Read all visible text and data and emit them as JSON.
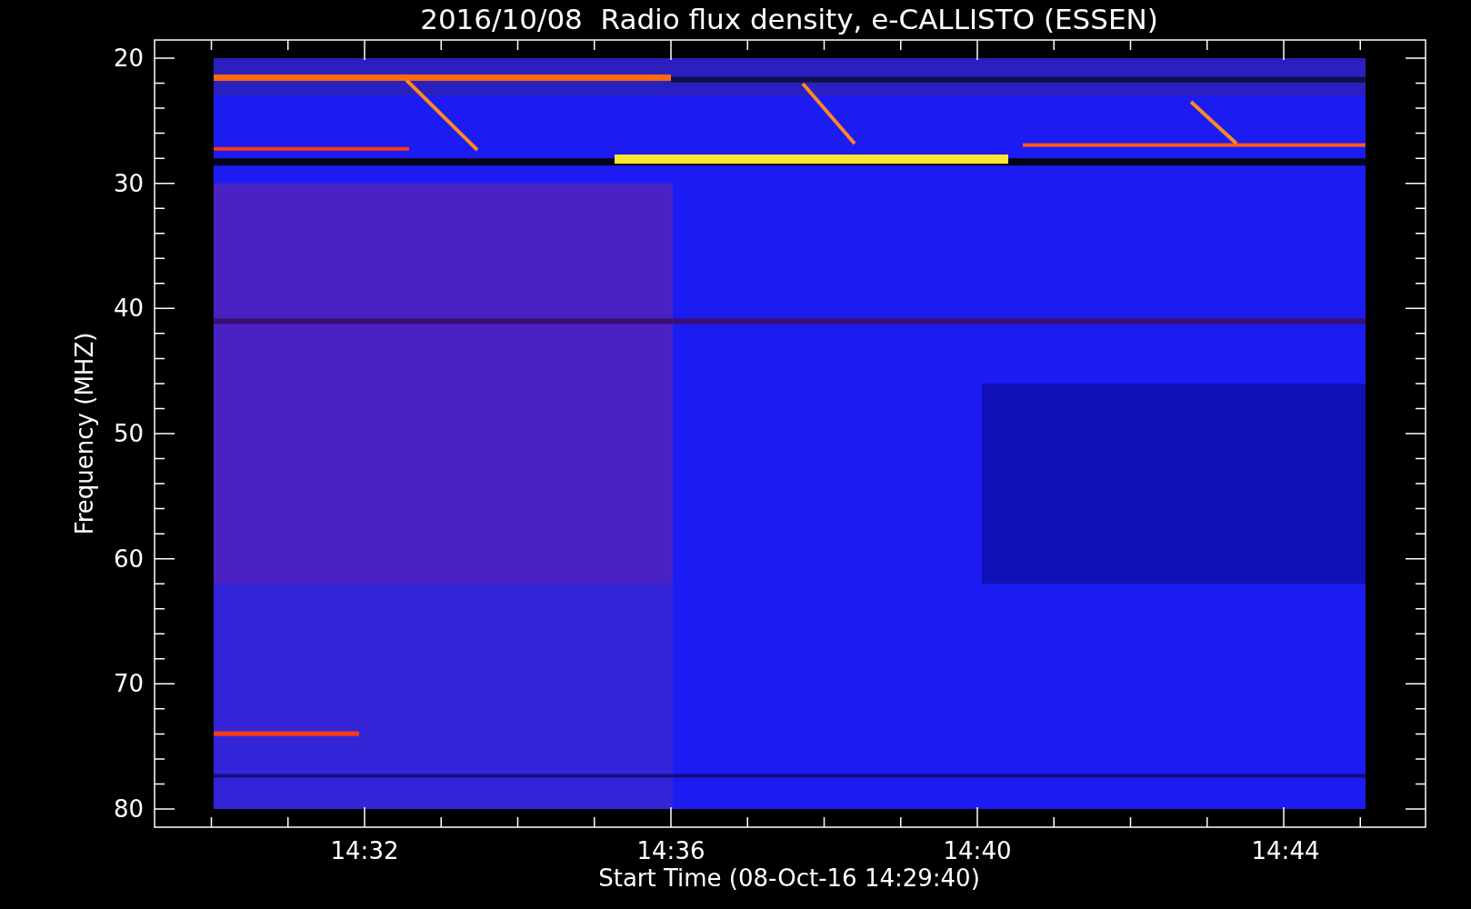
{
  "title": "2016/10/08  Radio flux density, e-CALLISTO (ESSEN)",
  "y_axis": {
    "label": "Frequency (MHZ)",
    "ticks": [
      "20",
      "30",
      "40",
      "50",
      "60",
      "70",
      "80"
    ]
  },
  "x_axis": {
    "label": "Start Time (08-Oct-16 14:29:40)",
    "ticks": [
      "14:32",
      "14:36",
      "14:40",
      "14:44"
    ]
  }
}
